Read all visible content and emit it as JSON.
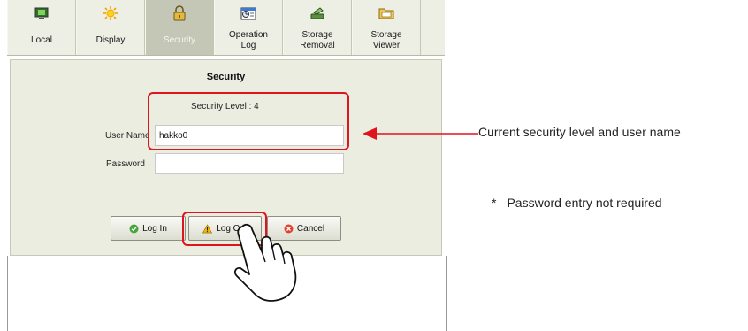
{
  "tabs": [
    {
      "label": "Local",
      "icon": "monitor-icon",
      "active": false
    },
    {
      "label": "Display",
      "icon": "sun-icon",
      "active": false
    },
    {
      "label": "Security",
      "icon": "padlock-icon",
      "active": true
    },
    {
      "label": "Operation Log",
      "line1": "Operation",
      "line2": "Log",
      "icon": "clock-log-icon",
      "active": false
    },
    {
      "label": "Storage Removal",
      "line1": "Storage",
      "line2": "Removal",
      "icon": "eject-card-icon",
      "active": false
    },
    {
      "label": "Storage Viewer",
      "line1": "Storage",
      "line2": "Viewer",
      "icon": "folder-icon",
      "active": false
    }
  ],
  "dialog": {
    "title": "Security",
    "security_level_text": "Security Level  :  4",
    "user_name_label": "User Name",
    "user_name_value": "hakko0",
    "password_label": "Password",
    "password_value": ""
  },
  "buttons": {
    "login": "Log In",
    "logout": "Log Out",
    "cancel": "Cancel"
  },
  "annotations": {
    "current_info": "Current security level and user name",
    "star": "*",
    "note": "Password entry not required"
  },
  "colors": {
    "highlight": "#e0141e",
    "active_tab": "#c5c7b6",
    "panel_bg": "#ecede1"
  }
}
